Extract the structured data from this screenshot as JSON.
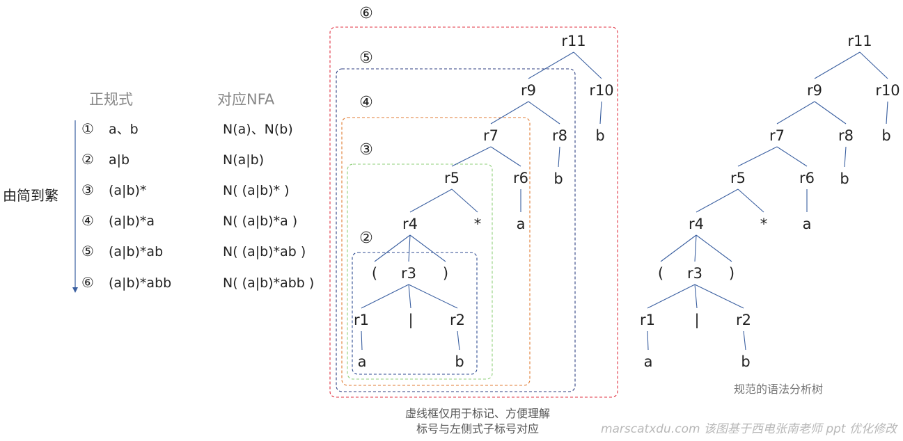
{
  "table": {
    "col_regex": "正规式",
    "col_nfa": "对应NFA",
    "side_label": "由简到繁",
    "rows": [
      {
        "num": "①",
        "regex": "a、b",
        "nfa": "N(a)、N(b)"
      },
      {
        "num": "②",
        "regex": "a|b",
        "nfa": "N(a|b)"
      },
      {
        "num": "③",
        "regex": "(a|b)*",
        "nfa": "N( (a|b)* )"
      },
      {
        "num": "④",
        "regex": "(a|b)*a",
        "nfa": "N( (a|b)*a )"
      },
      {
        "num": "⑤",
        "regex": "(a|b)*ab",
        "nfa": "N( (a|b)*ab )"
      },
      {
        "num": "⑥",
        "regex": "(a|b)*abb",
        "nfa": "N( (a|b)*abb )"
      }
    ]
  },
  "boxes": [
    {
      "label": "⑥",
      "color": "#e03040"
    },
    {
      "label": "⑤",
      "color": "#2c3e80"
    },
    {
      "label": "④",
      "color": "#e07a30"
    },
    {
      "label": "③",
      "color": "#8fcf7a"
    },
    {
      "label": "②",
      "color": "#2c4a90"
    }
  ],
  "tree": {
    "nodes": {
      "r11": "r11",
      "r9": "r9",
      "r10": "r10",
      "r7": "r7",
      "r8": "r8",
      "b10": "b",
      "r5": "r5",
      "r6": "r6",
      "b8": "b",
      "r4": "r4",
      "star": "*",
      "a6": "a",
      "lp": "(",
      "r3": "r3",
      "rp": ")",
      "r1": "r1",
      "bar": "|",
      "r2": "r2",
      "a1": "a",
      "b2": "b"
    },
    "edge_color": "#3a5fa0"
  },
  "captions": {
    "box_note_1": "虚线框仅用于标记、方便理解",
    "box_note_2": "标号与左侧式子标号对应",
    "tree_title": "规范的语法分析树",
    "watermark": "marscatxdu.com 该图基于西电张南老师 ppt 优化修改"
  }
}
